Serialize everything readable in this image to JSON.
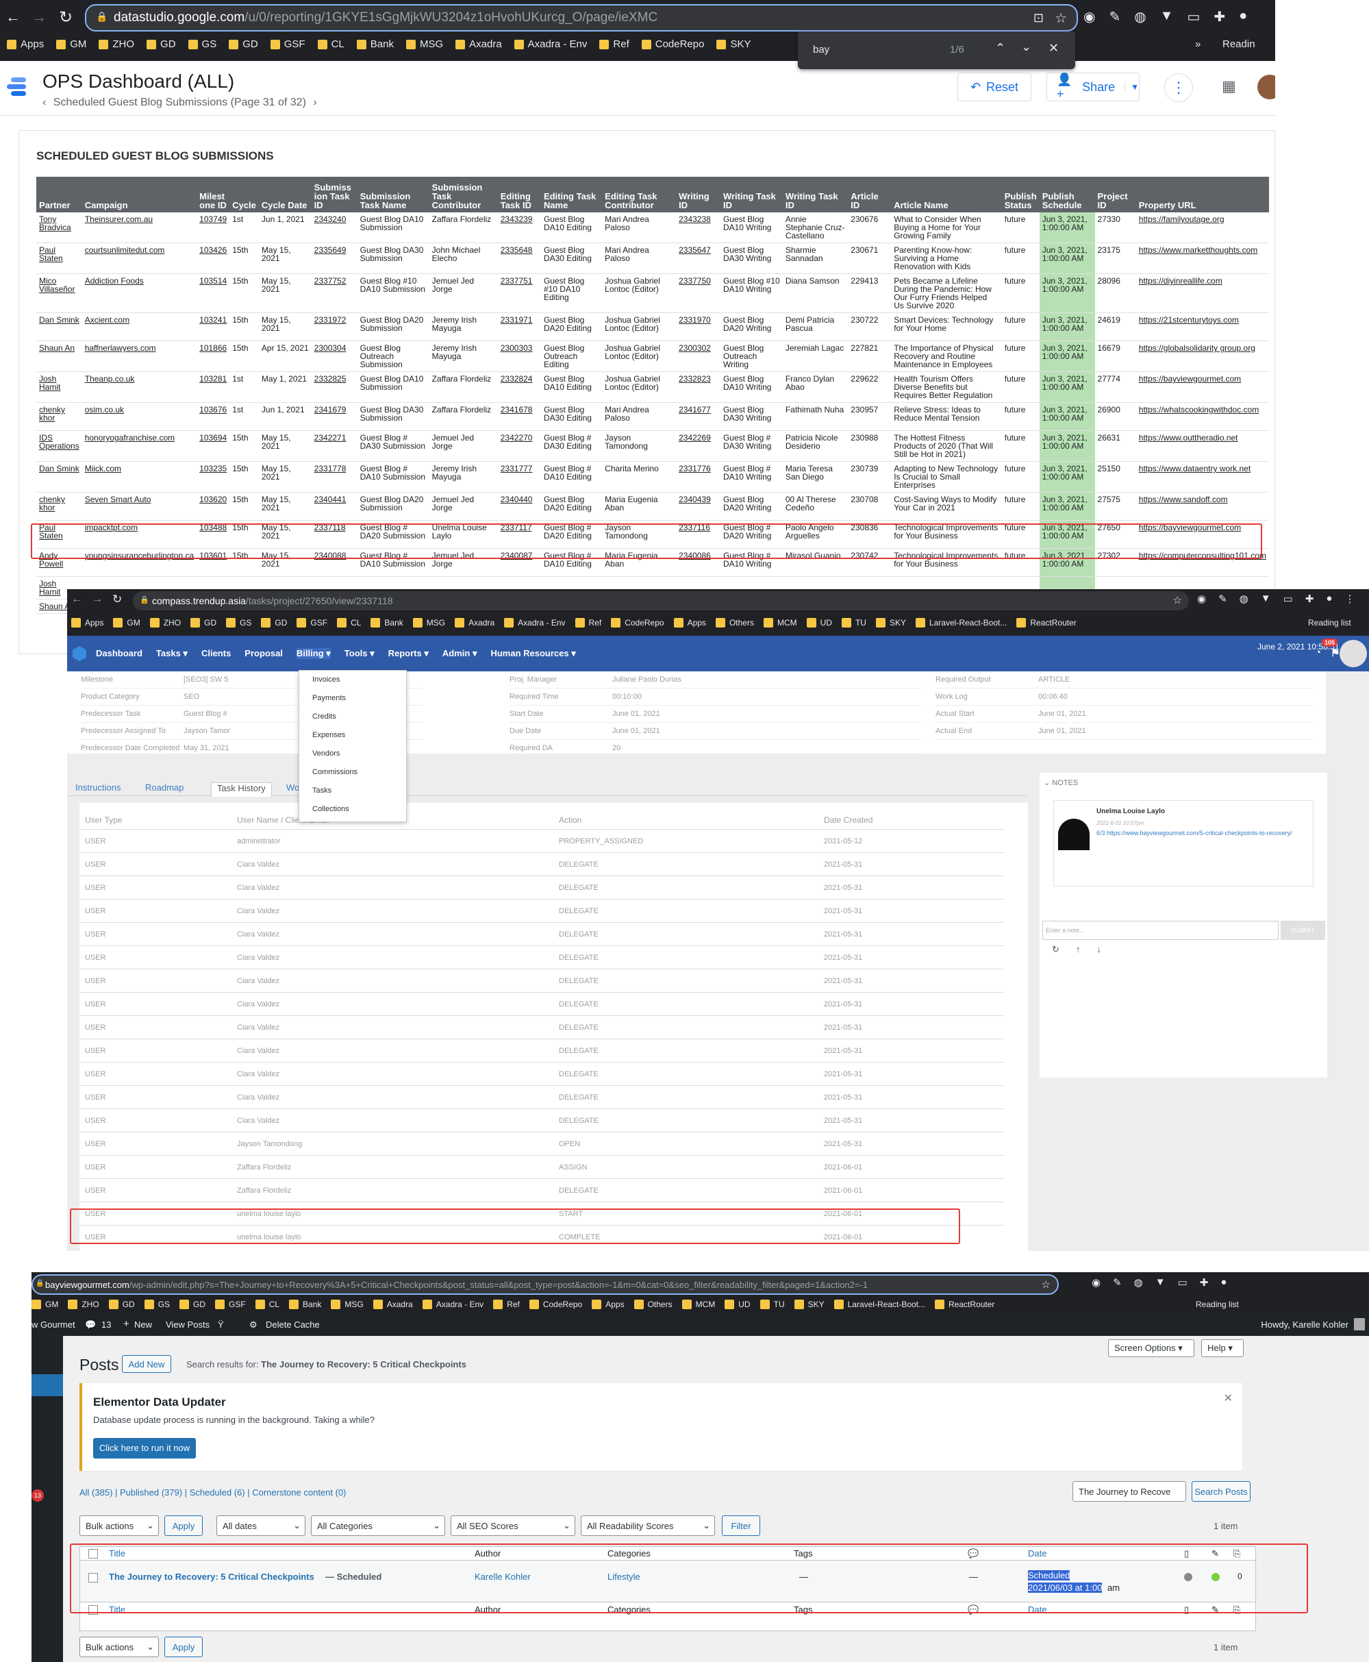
{
  "ds": {
    "url_domain": "datastudio.google.com",
    "url_path": "/u/0/reporting/1GKYE1sGgMjkWU3204z1oHvohUKurcg_O/page/ieXMC",
    "bookmarks": [
      "Apps",
      "GM",
      "ZHO",
      "GD",
      "GS",
      "GD",
      "GSF",
      "CL",
      "Bank",
      "MSG",
      "Axadra",
      "Axadra - Env",
      "Ref",
      "CodeRepo",
      "SKY"
    ],
    "bookmarks_more": "»",
    "reading_list": "Readin",
    "find_query": "bay",
    "find_count": "1/6",
    "title": "OPS Dashboard (ALL)",
    "subtitle": "Scheduled Guest Blog Submissions (Page 31 of 32)",
    "reset": "Reset",
    "share": "Share",
    "table_title": "SCHEDULED GUEST BLOG SUBMISSIONS",
    "headers": [
      "Partner",
      "Campaign",
      "Milest one ID",
      "Cycle",
      "Cycle Date",
      "Submiss ion Task ID",
      "Submission Task Name",
      "Submission Task Contributor",
      "Editing Task ID",
      "Editing Task Name",
      "Editing Task Contributor",
      "Writing ID",
      "Writing Task ID",
      "Writing Task ID",
      "Article ID",
      "Article Name",
      "Publish Status",
      "Publish Schedule",
      "Project ID",
      "Property URL"
    ],
    "rows": [
      [
        "Tony Bradvica",
        "Theinsurer.com.au",
        "103749",
        "1st",
        "Jun 1, 2021",
        "2343240",
        "Guest Blog DA10 Submission",
        "Zaffara Flordeliz",
        "2343239",
        "Guest Blog DA10 Editing",
        "Mari Andrea Paloso",
        "2343238",
        "Guest Blog DA10 Writing",
        "Annie Stephanie Cruz- Castellano",
        "230676",
        "What to Consider When Buying a Home for Your Growing Family",
        "future",
        "Jun 3, 2021, 1:00:00 AM",
        "27330",
        "https://familyoutage.org"
      ],
      [
        "Paul Staten",
        "courtsunlimitedut.com",
        "103426",
        "15th",
        "May 15, 2021",
        "2335649",
        "Guest Blog DA30 Submission",
        "John Michael Elecho",
        "2335648",
        "Guest Blog DA30 Editing",
        "Mari Andrea Paloso",
        "2335647",
        "Guest Blog DA30 Writing",
        "Sharmie Sannadan",
        "230671",
        "Parenting Know-how: Surviving a Home Renovation with Kids",
        "future",
        "Jun 3, 2021, 1:00:00 AM",
        "23175",
        "https://www.marketthoughts.com"
      ],
      [
        "Mico Villaseñor",
        "Addiction Foods",
        "103514",
        "15th",
        "May 15, 2021",
        "2337752",
        "Guest Blog #10 DA10 Submission",
        "Jemuel Jed Jorge",
        "2337751",
        "Guest Blog #10 DA10 Editing",
        "Joshua Gabriel Lontoc (Editor)",
        "2337750",
        "Guest Blog #10 DA10 Writing",
        "Diana Samson",
        "229413",
        "Pets Became a Lifeline During the Pandemic: How Our Furry Friends Helped Us Survive 2020",
        "future",
        "Jun 3, 2021, 1:00:00 AM",
        "28096",
        "https://diyinreallife.com"
      ],
      [
        "Dan Smink",
        "Axcient.com",
        "103241",
        "15th",
        "May 15, 2021",
        "2331972",
        "Guest Blog DA20 Submission",
        "Jeremy Irish Mayuga",
        "2331971",
        "Guest Blog DA20 Editing",
        "Joshua Gabriel Lontoc (Editor)",
        "2331970",
        "Guest Blog DA20 Writing",
        "Demi Patricia Pascua",
        "230722",
        "Smart Devices: Technology for Your Home",
        "future",
        "Jun 3, 2021, 1:00:00 AM",
        "24619",
        "https://21stcenturytoys.com"
      ],
      [
        "Shaun An",
        "haffnerlawyers.com",
        "101866",
        "15th",
        "Apr 15, 2021",
        "2300304",
        "Guest Blog Outreach Submission",
        "Jeremy Irish Mayuga",
        "2300303",
        "Guest Blog Outreach Editing",
        "Joshua Gabriel Lontoc (Editor)",
        "2300302",
        "Guest Blog Outreach Writing",
        "Jeremiah Lagac",
        "227821",
        "The Importance of Physical Recovery and Routine Maintenance in Employees",
        "future",
        "Jun 3, 2021, 1:00:00 AM",
        "16679",
        "https://globalsolidarity group.org"
      ],
      [
        "Josh Hamit",
        "Theanp.co.uk",
        "103281",
        "1st",
        "May 1, 2021",
        "2332825",
        "Guest Blog DA10 Submission",
        "Zaffara Flordeliz",
        "2332824",
        "Guest Blog DA10 Editing",
        "Joshua Gabriel Lontoc (Editor)",
        "2332823",
        "Guest Blog DA10 Writing",
        "Franco Dylan Abao",
        "229622",
        "Health Tourism Offers Diverse Benefits but Requires Better Regulation",
        "future",
        "Jun 3, 2021, 1:00:00 AM",
        "27774",
        "https://bayviewgourmet.com"
      ],
      [
        "chenky khor",
        "osim.co.uk",
        "103676",
        "1st",
        "Jun 1, 2021",
        "2341679",
        "Guest Blog DA30 Submission",
        "Zaffara Flordeliz",
        "2341678",
        "Guest Blog DA30 Editing",
        "Mari Andrea Paloso",
        "2341677",
        "Guest Blog DA30 Writing",
        "Fathimath Nuha",
        "230957",
        "Relieve Stress: Ideas to Reduce Mental Tension",
        "future",
        "Jun 3, 2021, 1:00:00 AM",
        "26900",
        "https://whatscookingwithdoc.com"
      ],
      [
        "IDS Operations",
        "honoryogafranchise.com",
        "103694",
        "15th",
        "May 15, 2021",
        "2342271",
        "Guest Blog # DA30 Submission",
        "Jemuel Jed Jorge",
        "2342270",
        "Guest Blog # DA30 Editing",
        "Jayson Tamondong",
        "2342269",
        "Guest Blog # DA30 Writing",
        "Patricia Nicole Desiderio",
        "230988",
        "The Hottest Fitness Products of 2020 (That Will Still be Hot in 2021)",
        "future",
        "Jun 3, 2021, 1:00:00 AM",
        "26631",
        "https://www.outtheradio.net"
      ],
      [
        "Dan Smink",
        "Miick.com",
        "103235",
        "15th",
        "May 15, 2021",
        "2331778",
        "Guest Blog # DA10 Submission",
        "Jeremy Irish Mayuga",
        "2331777",
        "Guest Blog # DA10 Editing",
        "Charita Merino",
        "2331776",
        "Guest Blog # DA10 Writing",
        "Maria Teresa San Diego",
        "230739",
        "Adapting to New Technology Is Crucial to Small Enterprises",
        "future",
        "Jun 3, 2021, 1:00:00 AM",
        "25150",
        "https://www.dataentry work.net"
      ],
      [
        "chenky khor",
        "Seven Smart Auto",
        "103620",
        "15th",
        "May 15, 2021",
        "2340441",
        "Guest Blog DA20 Submission",
        "Jemuel Jed Jorge",
        "2340440",
        "Guest Blog DA20 Editing",
        "Maria Eugenia Aban",
        "2340439",
        "Guest Blog DA20 Writing",
        "00 Al Therese Cedeño",
        "230708",
        "Cost-Saving Ways to Modify Your Car in 2021",
        "future",
        "Jun 3, 2021, 1:00:00 AM",
        "27575",
        "https://www.sandoff.com"
      ],
      [
        "Paul Staten",
        "impacktpt.com",
        "103488",
        "15th",
        "May 15, 2021",
        "2337118",
        "Guest Blog # DA20 Submission",
        "Unelma Louise Laylo",
        "2337117",
        "Guest Blog # DA20 Editing",
        "Jayson Tamondong",
        "2337116",
        "Guest Blog # DA20 Writing",
        "Paolo Angelo Arguelles",
        "230836",
        "Technological Improvements for Your Business",
        "future",
        "Jun 3, 2021, 1:00:00 AM",
        "27650",
        "https://bayviewgourmet.com"
      ],
      [
        "Andy Powell",
        "youngsinsuranceburlington.ca",
        "103601",
        "15th",
        "May 15, 2021",
        "2340088",
        "Guest Blog # DA10 Submission",
        "Jemuel Jed Jorge",
        "2340087",
        "Guest Blog # DA10 Editing",
        "Maria Eugenia Aban",
        "2340086",
        "Guest Blog # DA10 Writing",
        "Mirasol Guanio",
        "230742",
        "Technological Improvements for Your Business",
        "future",
        "Jun 3, 2021, 1:00:00 AM",
        "27302",
        "https://computerconsulting101.com"
      ],
      [
        "Josh Hamit",
        "",
        "",
        "",
        "",
        "",
        "",
        "",
        "",
        "",
        "",
        "",
        "",
        "",
        "",
        "",
        "",
        "",
        "",
        ""
      ],
      [
        "Shaun A",
        "",
        "",
        "",
        "",
        "",
        "",
        "",
        "",
        "",
        "",
        "",
        "",
        "",
        "",
        "",
        "",
        "",
        "",
        ""
      ]
    ],
    "row10_article": "Recovery: 5 Critical Checkpoints",
    "row10_article_prefix": "The Journey to"
  },
  "tu": {
    "url_domain": "compass.trendup.asia",
    "url_path": "/tasks/project/27650/view/2337118",
    "bookmarks": [
      "Apps",
      "GM",
      "ZHO",
      "GD",
      "GS",
      "GD",
      "GSF",
      "CL",
      "Bank",
      "MSG",
      "Axadra",
      "Axadra - Env",
      "Ref",
      "CodeRepo",
      "Apps",
      "Others",
      "MCM",
      "UD",
      "TU",
      "SKY",
      "Laravel-React-Boot...",
      "ReactRouter"
    ],
    "reading_list": "Reading list",
    "nav": [
      "Dashboard",
      "Tasks ▾",
      "Clients",
      "Proposal",
      "Billing ▾",
      "Tools ▾",
      "Reports ▾",
      "Admin ▾",
      "Human Resources ▾"
    ],
    "datetime": "June 2, 2021 10:58:51 AM",
    "badge": "105",
    "fields_left": [
      [
        "Milestone",
        "[SEO3] SW 5"
      ],
      [
        "Product Category",
        "SEO"
      ],
      [
        "Predecessor Task",
        "Guest Blog #"
      ],
      [
        "Predecessor Assigned To",
        "Jayson Tamor"
      ],
      [
        "Predecessor Date Completed",
        "May 31, 2021"
      ]
    ],
    "fields_mid": [
      [
        "Proj. Manager",
        "Juliane Paolo Durias"
      ],
      [
        "Required Time",
        "00:10:00"
      ],
      [
        "Start Date",
        "June 01, 2021"
      ],
      [
        "Due Date",
        "June 01, 2021"
      ],
      [
        "Required DA",
        "20"
      ]
    ],
    "fields_right": [
      [
        "Required Output",
        "ARTICLE"
      ],
      [
        "Work Log",
        "00:06:40"
      ],
      [
        "Actual Start",
        "June 01, 2021"
      ],
      [
        "Actual End",
        "June 01, 2021"
      ]
    ],
    "billing_menu": [
      "Invoices",
      "Payments",
      "Credits",
      "Expenses",
      "Vendors",
      "Commissions",
      "Tasks",
      "Collections"
    ],
    "tabs": [
      "Instructions",
      "Roadmap",
      "Task History",
      "Wor"
    ],
    "hist_headers": [
      "User Type",
      "User Name / Client Email",
      "Action",
      "Date Created"
    ],
    "hist_rows": [
      [
        "USER",
        "administrator",
        "PROPERTY_ASSIGNED",
        "2021-05-12"
      ],
      [
        "USER",
        "Ciara Valdez",
        "DELEGATE",
        "2021-05-31"
      ],
      [
        "USER",
        "Ciara Valdez",
        "DELEGATE",
        "2021-05-31"
      ],
      [
        "USER",
        "Ciara Valdez",
        "DELEGATE",
        "2021-05-31"
      ],
      [
        "USER",
        "Ciara Valdez",
        "DELEGATE",
        "2021-05-31"
      ],
      [
        "USER",
        "Ciara Valdez",
        "DELEGATE",
        "2021-05-31"
      ],
      [
        "USER",
        "Ciara Valdez",
        "DELEGATE",
        "2021-05-31"
      ],
      [
        "USER",
        "Ciara Valdez",
        "DELEGATE",
        "2021-05-31"
      ],
      [
        "USER",
        "Ciara Valdez",
        "DELEGATE",
        "2021-05-31"
      ],
      [
        "USER",
        "Ciara Valdez",
        "DELEGATE",
        "2021-05-31"
      ],
      [
        "USER",
        "Ciara Valdez",
        "DELEGATE",
        "2021-05-31"
      ],
      [
        "USER",
        "Ciara Valdez",
        "DELEGATE",
        "2021-05-31"
      ],
      [
        "USER",
        "Ciara Valdez",
        "DELEGATE",
        "2021-05-31"
      ],
      [
        "USER",
        "Jayson Tamondong",
        "OPEN",
        "2021-05-31"
      ],
      [
        "USER",
        "Zaffara Flordeliz",
        "ASSIGN",
        "2021-06-01"
      ],
      [
        "USER",
        "Zaffara Flordeliz",
        "DELEGATE",
        "2021-06-01"
      ],
      [
        "USER",
        "unelma louise laylo",
        "START",
        "2021-06-01"
      ],
      [
        "USER",
        "unelma louise laylo",
        "COMPLETE",
        "2021-06-01"
      ]
    ],
    "notes_title": "NOTES",
    "note_author": "Unelma Louise Laylo",
    "note_time": "2021-6-01 10:57pm",
    "note_text": "6/3 https://www.bayviewgourmet.com/5-critical-checkpoints-to-recovery/",
    "note_placeholder": "Enter a note...",
    "note_submit": "SUBMIT"
  },
  "wp": {
    "url_domain": "bayviewgourmet.com",
    "url_path": "/wp-admin/edit.php?s=The+Journey+to+Recovery%3A+5+Critical+Checkpoints&post_status=all&post_type=post&action=-1&m=0&cat=0&seo_filter&readability_filter&paged=1&action2=-1",
    "bookmarks": [
      "GM",
      "ZHO",
      "GD",
      "GS",
      "GD",
      "GSF",
      "CL",
      "Bank",
      "MSG",
      "Axadra",
      "Axadra - Env",
      "Ref",
      "CodeRepo",
      "Apps",
      "Others",
      "MCM",
      "UD",
      "TU",
      "SKY",
      "Laravel-React-Boot...",
      "ReactRouter"
    ],
    "reading_list": "Reading list",
    "adminbar": [
      "w Gourmet",
      "13",
      "New",
      "View Posts",
      "Delete Cache"
    ],
    "howdy": "Howdy, Karelle Kohler",
    "page_title": "Posts",
    "add_new": "Add New",
    "search_results": "Search results for:",
    "search_term": "The Journey to Recovery: 5 Critical Checkpoints",
    "screen_options": "Screen Options ▾",
    "help": "Help ▾",
    "notice_title": "Elementor Data Updater",
    "notice_text": "Database update process is running in the background. Taking a while?",
    "notice_button": "Click here to run it now",
    "status_links": "All (385) | Published (379) | Scheduled (6) | Cornerstone content (0)",
    "search_input": "The Journey to Recove",
    "search_button": "Search Posts",
    "bulk": "Bulk actions",
    "apply": "Apply",
    "all_dates": "All dates",
    "all_categories": "All Categories",
    "all_seo": "All SEO Scores",
    "all_readability": "All Readability Scores",
    "filter": "Filter",
    "items": "1 item",
    "cols": [
      "Title",
      "Author",
      "Categories",
      "Tags",
      "Date"
    ],
    "post_title": "The Journey to Recovery: 5 Critical Checkpoints",
    "post_state": "— Scheduled",
    "post_author": "Karelle Kohler",
    "post_category": "Lifestyle",
    "post_tags": "—",
    "post_comments": "—",
    "post_date_status": "Scheduled",
    "post_date": "2021/06/03 at 1:00",
    "post_date_suffix": "am",
    "post_count": "0",
    "menu_badge": "13"
  }
}
